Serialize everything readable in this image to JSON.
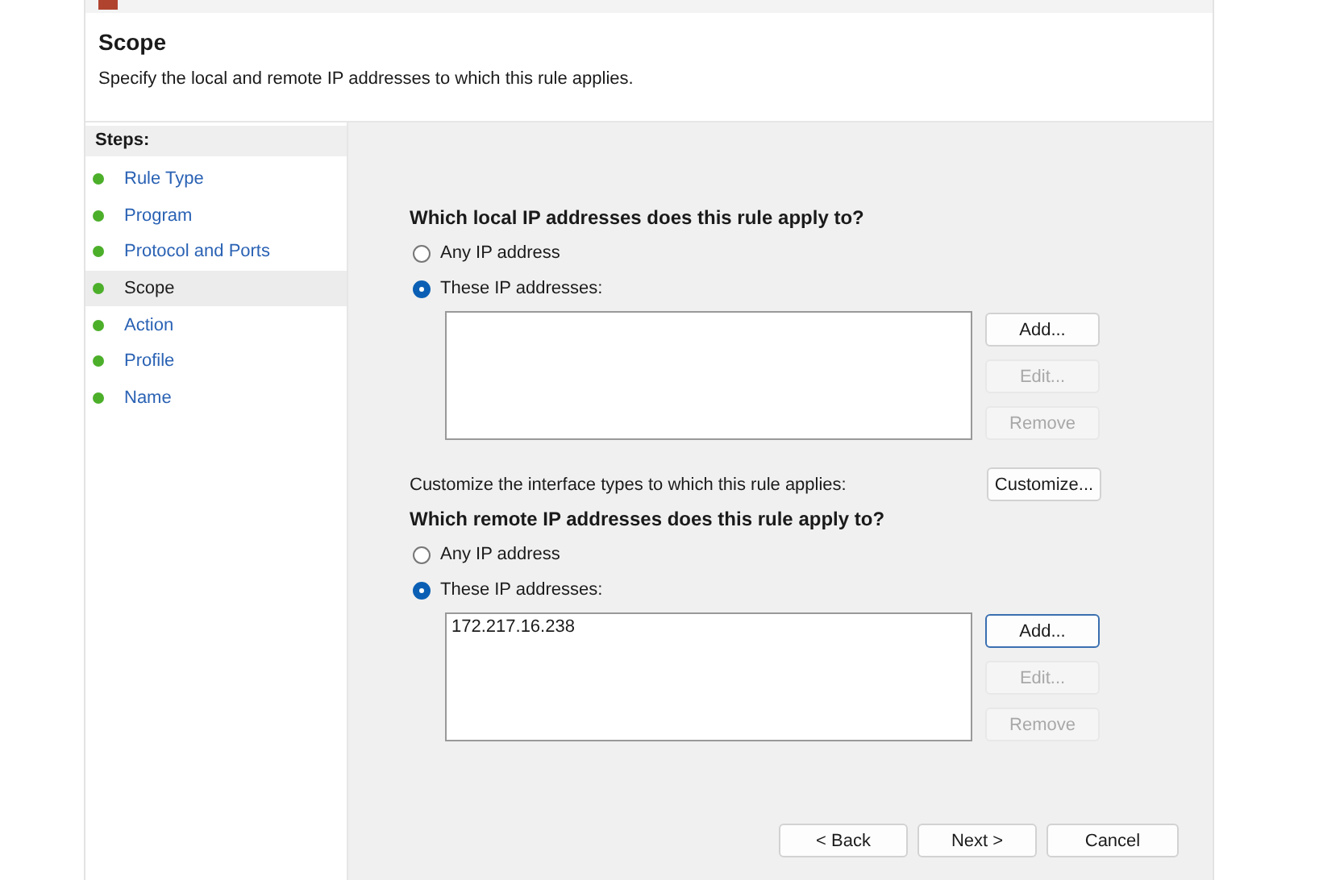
{
  "header": {
    "title": "Scope",
    "description": "Specify the local and remote IP addresses to which this rule applies."
  },
  "steps": {
    "heading": "Steps:",
    "items": [
      {
        "label": "Rule Type",
        "selected": false
      },
      {
        "label": "Program",
        "selected": false
      },
      {
        "label": "Protocol and Ports",
        "selected": false
      },
      {
        "label": "Scope",
        "selected": true
      },
      {
        "label": "Action",
        "selected": false
      },
      {
        "label": "Profile",
        "selected": false
      },
      {
        "label": "Name",
        "selected": false
      }
    ]
  },
  "local": {
    "question": "Which local IP addresses does this rule apply to?",
    "options": [
      {
        "label": "Any IP address",
        "selected": false
      },
      {
        "label": "These IP addresses:",
        "selected": true
      }
    ],
    "buttons": [
      {
        "label": "Add...",
        "disabled": false,
        "focused": false
      },
      {
        "label": "Edit...",
        "disabled": true,
        "focused": false
      },
      {
        "label": "Remove",
        "disabled": true,
        "focused": false
      }
    ]
  },
  "customize": {
    "text": "Customize the interface types to which this rule applies:",
    "button": "Customize..."
  },
  "remote": {
    "question": "Which remote IP addresses does this rule apply to?",
    "options": [
      {
        "label": "Any IP address",
        "selected": false
      },
      {
        "label": "These IP addresses:",
        "selected": true
      }
    ],
    "addresses": [
      "172.217.16.238"
    ],
    "buttons": [
      {
        "label": "Add...",
        "disabled": false,
        "focused": true
      },
      {
        "label": "Edit...",
        "disabled": true,
        "focused": false
      },
      {
        "label": "Remove",
        "disabled": true,
        "focused": false
      }
    ]
  },
  "footer_buttons": [
    "< Back",
    "Next >",
    "Cancel"
  ]
}
